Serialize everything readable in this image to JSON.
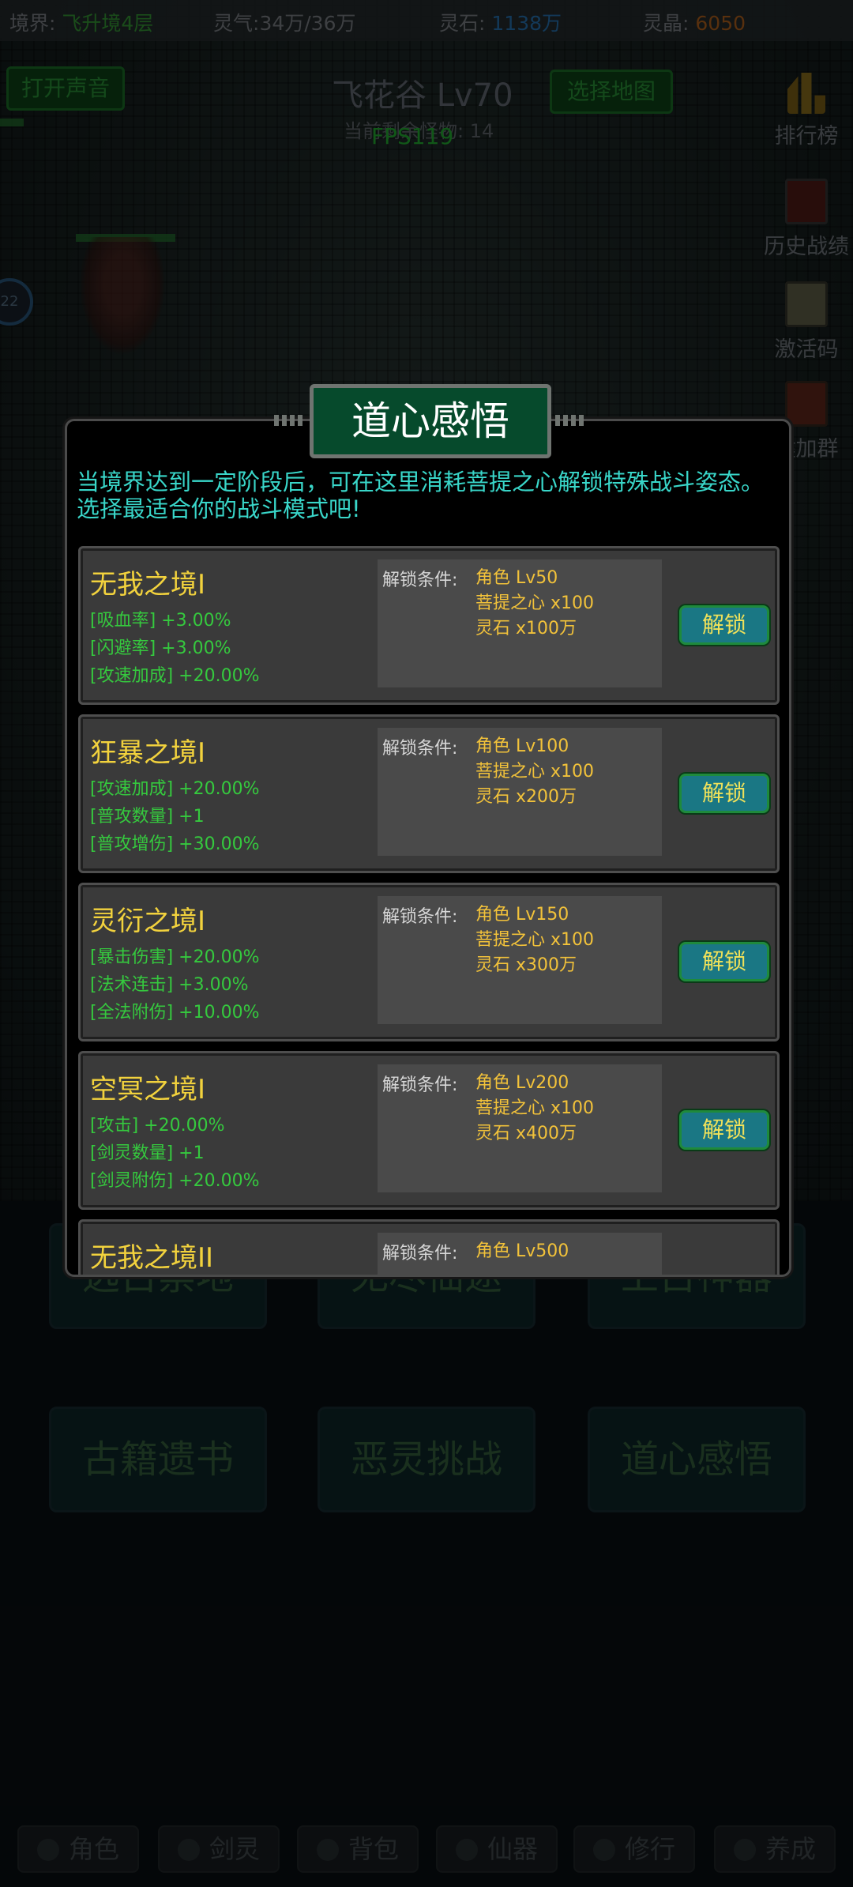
{
  "topbar": {
    "realm_label": "境界:",
    "realm_value": "飞升境4层",
    "qi_label": "灵气:",
    "qi_value": "34万/36万",
    "stone_label": "灵石:",
    "stone_value": "1138万",
    "crystal_label": "灵晶:",
    "crystal_value": "6050"
  },
  "header": {
    "sound_button": "打开声音",
    "map_title": "飞花谷 Lv70",
    "remaining": "当前剩余怪物: 14",
    "map_button": "选择地图",
    "fps": "FPS119",
    "level_badge": "22"
  },
  "side_menu": [
    "排行榜",
    "历史战绩",
    "激活码",
    "键加群"
  ],
  "main_menu": [
    "远古禁地",
    "无尽仙途",
    "上古神器",
    "古籍遗书",
    "恶灵挑战",
    "道心感悟"
  ],
  "bottom_tabs": [
    "角色",
    "剑灵",
    "背包",
    "仙器",
    "修行",
    "养成"
  ],
  "modal": {
    "title": "道心感悟",
    "description": "当境界达到一定阶段后，可在这里消耗菩提之心解锁特殊战斗姿态。选择最适合你的战斗模式吧!",
    "condition_label": "解锁条件:",
    "unlock_label": "解锁",
    "cards": [
      {
        "name": "无我之境I",
        "attrs": [
          "[吸血率] +3.00%",
          "[闪避率] +3.00%",
          "[攻速加成] +20.00%"
        ],
        "conditions": [
          "角色 Lv50",
          "菩提之心 x100",
          "灵石 x100万"
        ]
      },
      {
        "name": "狂暴之境I",
        "attrs": [
          "[攻速加成] +20.00%",
          "[普攻数量] +1",
          "[普攻增伤] +30.00%"
        ],
        "conditions": [
          "角色 Lv100",
          "菩提之心 x100",
          "灵石 x200万"
        ]
      },
      {
        "name": "灵衍之境I",
        "attrs": [
          "[暴击伤害] +20.00%",
          "[法术连击] +3.00%",
          "[全法附伤] +10.00%"
        ],
        "conditions": [
          "角色 Lv150",
          "菩提之心 x100",
          "灵石 x300万"
        ]
      },
      {
        "name": "空冥之境I",
        "attrs": [
          "[攻击] +20.00%",
          "[剑灵数量] +1",
          "[剑灵附伤] +20.00%"
        ],
        "conditions": [
          "角色 Lv200",
          "菩提之心 x100",
          "灵石 x400万"
        ]
      },
      {
        "name": "无我之境II",
        "attrs": [],
        "conditions": [
          "角色 Lv500"
        ]
      }
    ]
  },
  "colors": {
    "accent_green": "#35c93e",
    "title_yellow": "#f2d23d",
    "cyan_text": "#39d6c9"
  }
}
